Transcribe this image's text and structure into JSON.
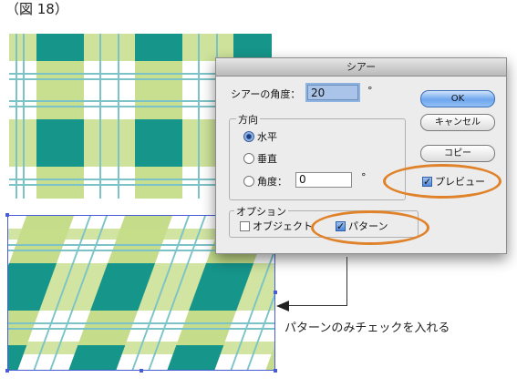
{
  "figure": {
    "title": "（図 18）"
  },
  "dialog": {
    "title": "シアー",
    "angle_label": "シアーの角度：",
    "angle_value": "20",
    "degree_symbol": "°",
    "direction": {
      "title": "方向",
      "horizontal": "水平",
      "vertical": "垂直",
      "angle_label": "角度：",
      "angle_value": "0",
      "selected": "水平"
    },
    "options": {
      "title": "オプション",
      "object_label": "オブジェクト",
      "object_checked": false,
      "pattern_label": "パターン",
      "pattern_checked": true
    },
    "buttons": {
      "ok": "OK",
      "cancel": "キャンセル",
      "copy": "コピー"
    },
    "preview_label": "プレビュー",
    "preview_checked": true
  },
  "annotation": {
    "caption": "パターンのみチェックを入れる"
  },
  "colors": {
    "plaid_light_green": "#c5dd8a",
    "plaid_teal": "#16958b",
    "plaid_stripe": "#7cc3c8",
    "highlight_ring": "#e0822a",
    "selection_blue": "#4a5bd6"
  }
}
